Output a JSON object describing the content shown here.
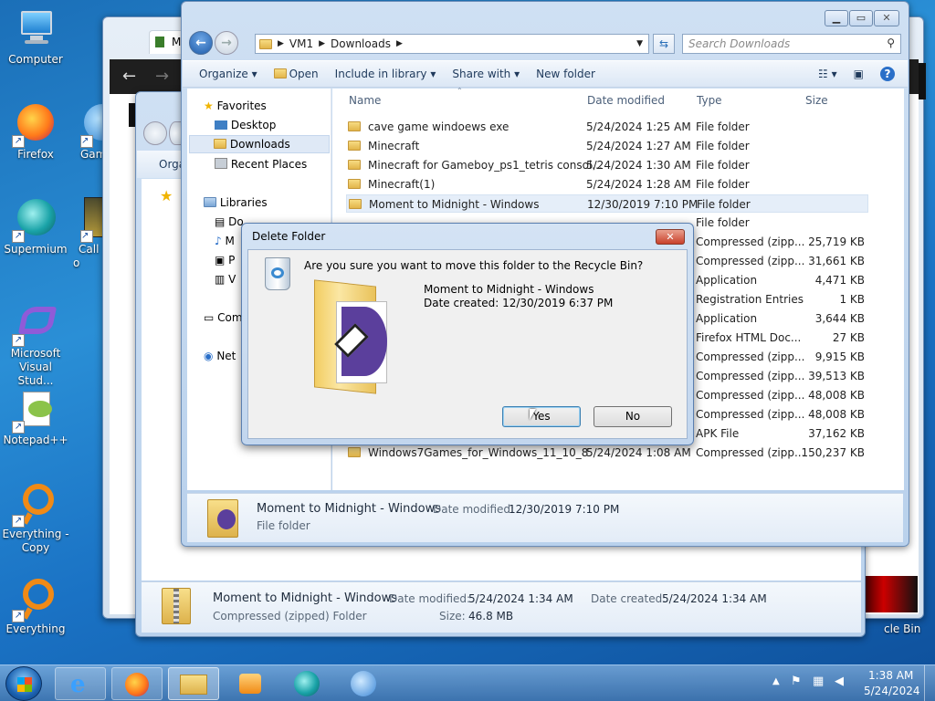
{
  "desktop": {
    "icons": [
      {
        "label": "Computer",
        "icon": "computer-icon"
      },
      {
        "label": "Firefox",
        "icon": "firefox-icon"
      },
      {
        "label": "Gam",
        "icon": "game-icon"
      },
      {
        "label": "Supermium",
        "icon": "supermium-icon"
      },
      {
        "label": "Call o",
        "icon": "call-of-duty-icon"
      },
      {
        "label": "Microsoft Visual Stud...",
        "icon": "visual-studio-icon"
      },
      {
        "label": "Notepad++",
        "icon": "notepadpp-icon"
      },
      {
        "label": "Everything - Copy",
        "icon": "everything-icon"
      },
      {
        "label": "Everything",
        "icon": "everything-icon"
      }
    ],
    "recycle_partial": "cle Bin"
  },
  "back_window": {
    "title_partial": "M",
    "organize_partial": "Orga",
    "details": {
      "name": "Moment to Midnight - Windows",
      "modified_label": "Date modified:",
      "modified": "5/24/2024 1:34 AM",
      "created_label": "Date created:",
      "created": "5/24/2024 1:34 AM",
      "type": "Compressed (zipped) Folder",
      "size_label": "Size:",
      "size": "46.8 MB"
    }
  },
  "explorer": {
    "address": [
      "VM1",
      "Downloads"
    ],
    "search_placeholder": "Search Downloads",
    "commands": [
      "Organize",
      "Open",
      "Include in library",
      "Share with",
      "New folder"
    ],
    "nav": {
      "favorites": "Favorites",
      "desktop": "Desktop",
      "downloads": "Downloads",
      "recent": "Recent Places",
      "libraries": "Libraries",
      "lib_items": [
        "Do",
        "M",
        "P",
        "V"
      ],
      "computer": "Com",
      "network": "Net"
    },
    "columns": {
      "name": "Name",
      "date": "Date modified",
      "type": "Type",
      "size": "Size"
    },
    "rows": [
      {
        "name": "cave game windoews exe",
        "date": "5/24/2024 1:25 AM",
        "type": "File folder",
        "size": ""
      },
      {
        "name": "Minecraft",
        "date": "5/24/2024 1:27 AM",
        "type": "File folder",
        "size": ""
      },
      {
        "name": "Minecraft for Gameboy_ps1_tetris consol...",
        "date": "5/24/2024 1:30 AM",
        "type": "File folder",
        "size": ""
      },
      {
        "name": "Minecraft(1)",
        "date": "5/24/2024 1:28 AM",
        "type": "File folder",
        "size": ""
      },
      {
        "name": "Moment to Midnight - Windows",
        "date": "12/30/2019 7:10 PM",
        "type": "File folder",
        "size": ""
      },
      {
        "name": "",
        "date": "",
        "type": "File folder",
        "size": ""
      },
      {
        "name": "",
        "date": "",
        "type": "Compressed (zipp...",
        "size": "25,719 KB"
      },
      {
        "name": "",
        "date": "",
        "type": "Compressed (zipp...",
        "size": "31,661 KB"
      },
      {
        "name": "",
        "date": "",
        "type": "Application",
        "size": "4,471 KB"
      },
      {
        "name": "",
        "date": "",
        "type": "Registration Entries",
        "size": "1 KB"
      },
      {
        "name": "",
        "date": "",
        "type": "Application",
        "size": "3,644 KB"
      },
      {
        "name": "",
        "date": "",
        "type": "Firefox HTML Doc...",
        "size": "27 KB"
      },
      {
        "name": "",
        "date": "",
        "type": "Compressed (zipp...",
        "size": "9,915 KB"
      },
      {
        "name": "",
        "date": "",
        "type": "Compressed (zipp...",
        "size": "39,513 KB"
      },
      {
        "name": "",
        "date": "",
        "type": "Compressed (zipp...",
        "size": "48,008 KB"
      },
      {
        "name": "",
        "date": "",
        "type": "Compressed (zipp...",
        "size": "48,008 KB"
      },
      {
        "name": "",
        "date": "",
        "type": "APK File",
        "size": "37,162 KB"
      },
      {
        "name": "Windows7Games_for_Windows_11_10_8",
        "date": "5/24/2024 1:08 AM",
        "type": "Compressed (zipp...",
        "size": "150,237 KB"
      }
    ],
    "details": {
      "name": "Moment to Midnight - Windows",
      "modified_label": "Date modified:",
      "modified": "12/30/2019 7:10 PM",
      "type": "File folder"
    }
  },
  "dialog": {
    "title": "Delete Folder",
    "question": "Are you sure you want to move this folder to the Recycle Bin?",
    "item_name": "Moment to Midnight - Windows",
    "item_created": "Date created: 12/30/2019 6:37 PM",
    "yes": "Yes",
    "no": "No"
  },
  "taskbar": {
    "time": "1:38 AM",
    "date": "5/24/2024"
  }
}
